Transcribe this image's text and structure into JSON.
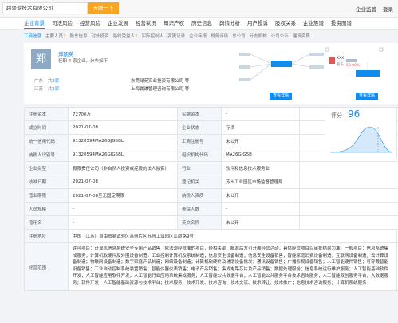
{
  "search": {
    "value": "超聚变技术有限公司",
    "button_label": "天眼一下"
  },
  "top_links": [
    "企业监管",
    "登录"
  ],
  "main_nav": [
    {
      "label": "企业背景",
      "active": true
    },
    {
      "label": "司法风险",
      "active": false
    },
    {
      "label": "经营风险",
      "active": false
    },
    {
      "label": "企业发展",
      "active": false
    },
    {
      "label": "经营状况",
      "active": false
    },
    {
      "label": "知识产权",
      "active": false
    },
    {
      "label": "历史信息",
      "active": false
    },
    {
      "label": "舆情分析",
      "active": false
    },
    {
      "label": "用户投诉",
      "active": false
    },
    {
      "label": "股权关系",
      "active": false
    },
    {
      "label": "企业族谱",
      "active": false
    },
    {
      "label": "投资图谱",
      "active": false
    }
  ],
  "sub_nav": [
    {
      "label": "工商信息",
      "count": "",
      "active": true
    },
    {
      "label": "主要人员",
      "count": "2",
      "active": false
    },
    {
      "label": "股东信息",
      "count": "",
      "active": false
    },
    {
      "label": "对外投资",
      "count": "",
      "active": false
    },
    {
      "label": "最终受益人",
      "count": "2",
      "active": false
    },
    {
      "label": "实际控制人",
      "count": "",
      "active": false
    },
    {
      "label": "变更记录",
      "count": "",
      "active": false
    },
    {
      "label": "企业年报",
      "count": "",
      "active": false
    },
    {
      "label": "税务评级",
      "count": "",
      "active": false
    },
    {
      "label": "总公司",
      "count": "",
      "active": false
    },
    {
      "label": "分支机构",
      "count": "",
      "active": false
    },
    {
      "label": "公司公示",
      "count": "",
      "active": false
    },
    {
      "label": "建筑资质",
      "count": "",
      "active": false
    }
  ],
  "card": {
    "logo_char": "郑",
    "person_name": "郑朋英",
    "person_tag": "任职",
    "person_role": "任职 4 家企业，分布如下",
    "regions": [
      {
        "name": "广东",
        "count": "共2家"
      },
      {
        "name": "江苏",
        "count": "共2家"
      }
    ],
    "related_companies": [
      "东莞绿苑实业投资有限公司 等",
      "上海襄谦管理咨询有限公司 等"
    ],
    "graph_button": "查看详情",
    "right_button": "查看详情",
    "right_labels": [
      "XXX",
      "股东"
    ],
    "right_percent": "50.00%"
  },
  "score": {
    "label": "评分",
    "value": "96"
  },
  "table": {
    "rows": [
      {
        "l1": "注册资本",
        "v1": "72700万",
        "l2": "实缴资本",
        "v2": "-"
      },
      {
        "l1": "成立时间",
        "v1": "2021-07-08",
        "l2": "企业状态",
        "v2": "存续"
      },
      {
        "l1": "统一信用代码",
        "v1": "91320594MA26GJG5BL",
        "l2": "工商注册号",
        "v2": "未公开"
      },
      {
        "l1": "纳税人识别号",
        "v1": "91320594MA26GJG5BL",
        "l2": "组织机构代码",
        "v2": "MA26GJG5B"
      },
      {
        "l1": "企业类型",
        "v1": "有限责任公司（非自然人投资或控股的法人独资）",
        "l2": "行业",
        "v2": "软件和信息技术服务业"
      },
      {
        "l1": "核准日期",
        "v1": "2021-07-08",
        "l2": "登记机关",
        "v2": "苏州工业园区市场监督管理局"
      },
      {
        "l1": "营业期限",
        "v1": "2021-07-08至无固定期限",
        "l2": "纳税人资质",
        "v2": "未公开"
      },
      {
        "l1": "人员规模",
        "v1": "-",
        "l2": "参保人数",
        "v2": "-"
      },
      {
        "l1": "曾用名",
        "v1": "-",
        "l2": "英文名称",
        "v2": "未公开"
      }
    ],
    "address_label": "注册地址",
    "address": "中国（江苏）自由贸易试验区苏州片区苏州工业园区江韵路9号",
    "scope_label": "经营范围",
    "scope": "许可项目：计算机信息系统安全专用产品销售（依法须经批准的项目，经相关部门批准后方可开展经营活动，具体经营项目以审批结果为准）一般项目：信息系统集成服务；计算机软硬件及外围设备制造；工业控制计算机及系统制造；信息安全设备制造；信息安全设备销售；智能家庭消费设备制造；互联网设备制造；云计算设备制造；物联网设备制造；数字家庭产品制造；网络设备制造；计算机软硬件及辅助设备批发；通讯设备销售；广播影视设备销售；人工智能硬件销售；可穿戴智能设备销售；工业自动控制系统装置销售；智能仪器仪表销售；电子产品销售；集成电路芯片及产品销售；数据处理服务；信息系统运行维护服务；人工智能基础软件开发；人工智能应用软件开发；人工智能行业应用系统集成服务；人工智能公共数据平台；人工智能公共服务平台技术咨询服务；人工智能双创服务平台；大数据服务；软件开发；人工智能基础资源与技术平台；技术服务、技术开发、技术咨询、技术交流、技术转让、技术推广；信息技术咨询服务；计算机系统服务"
  }
}
